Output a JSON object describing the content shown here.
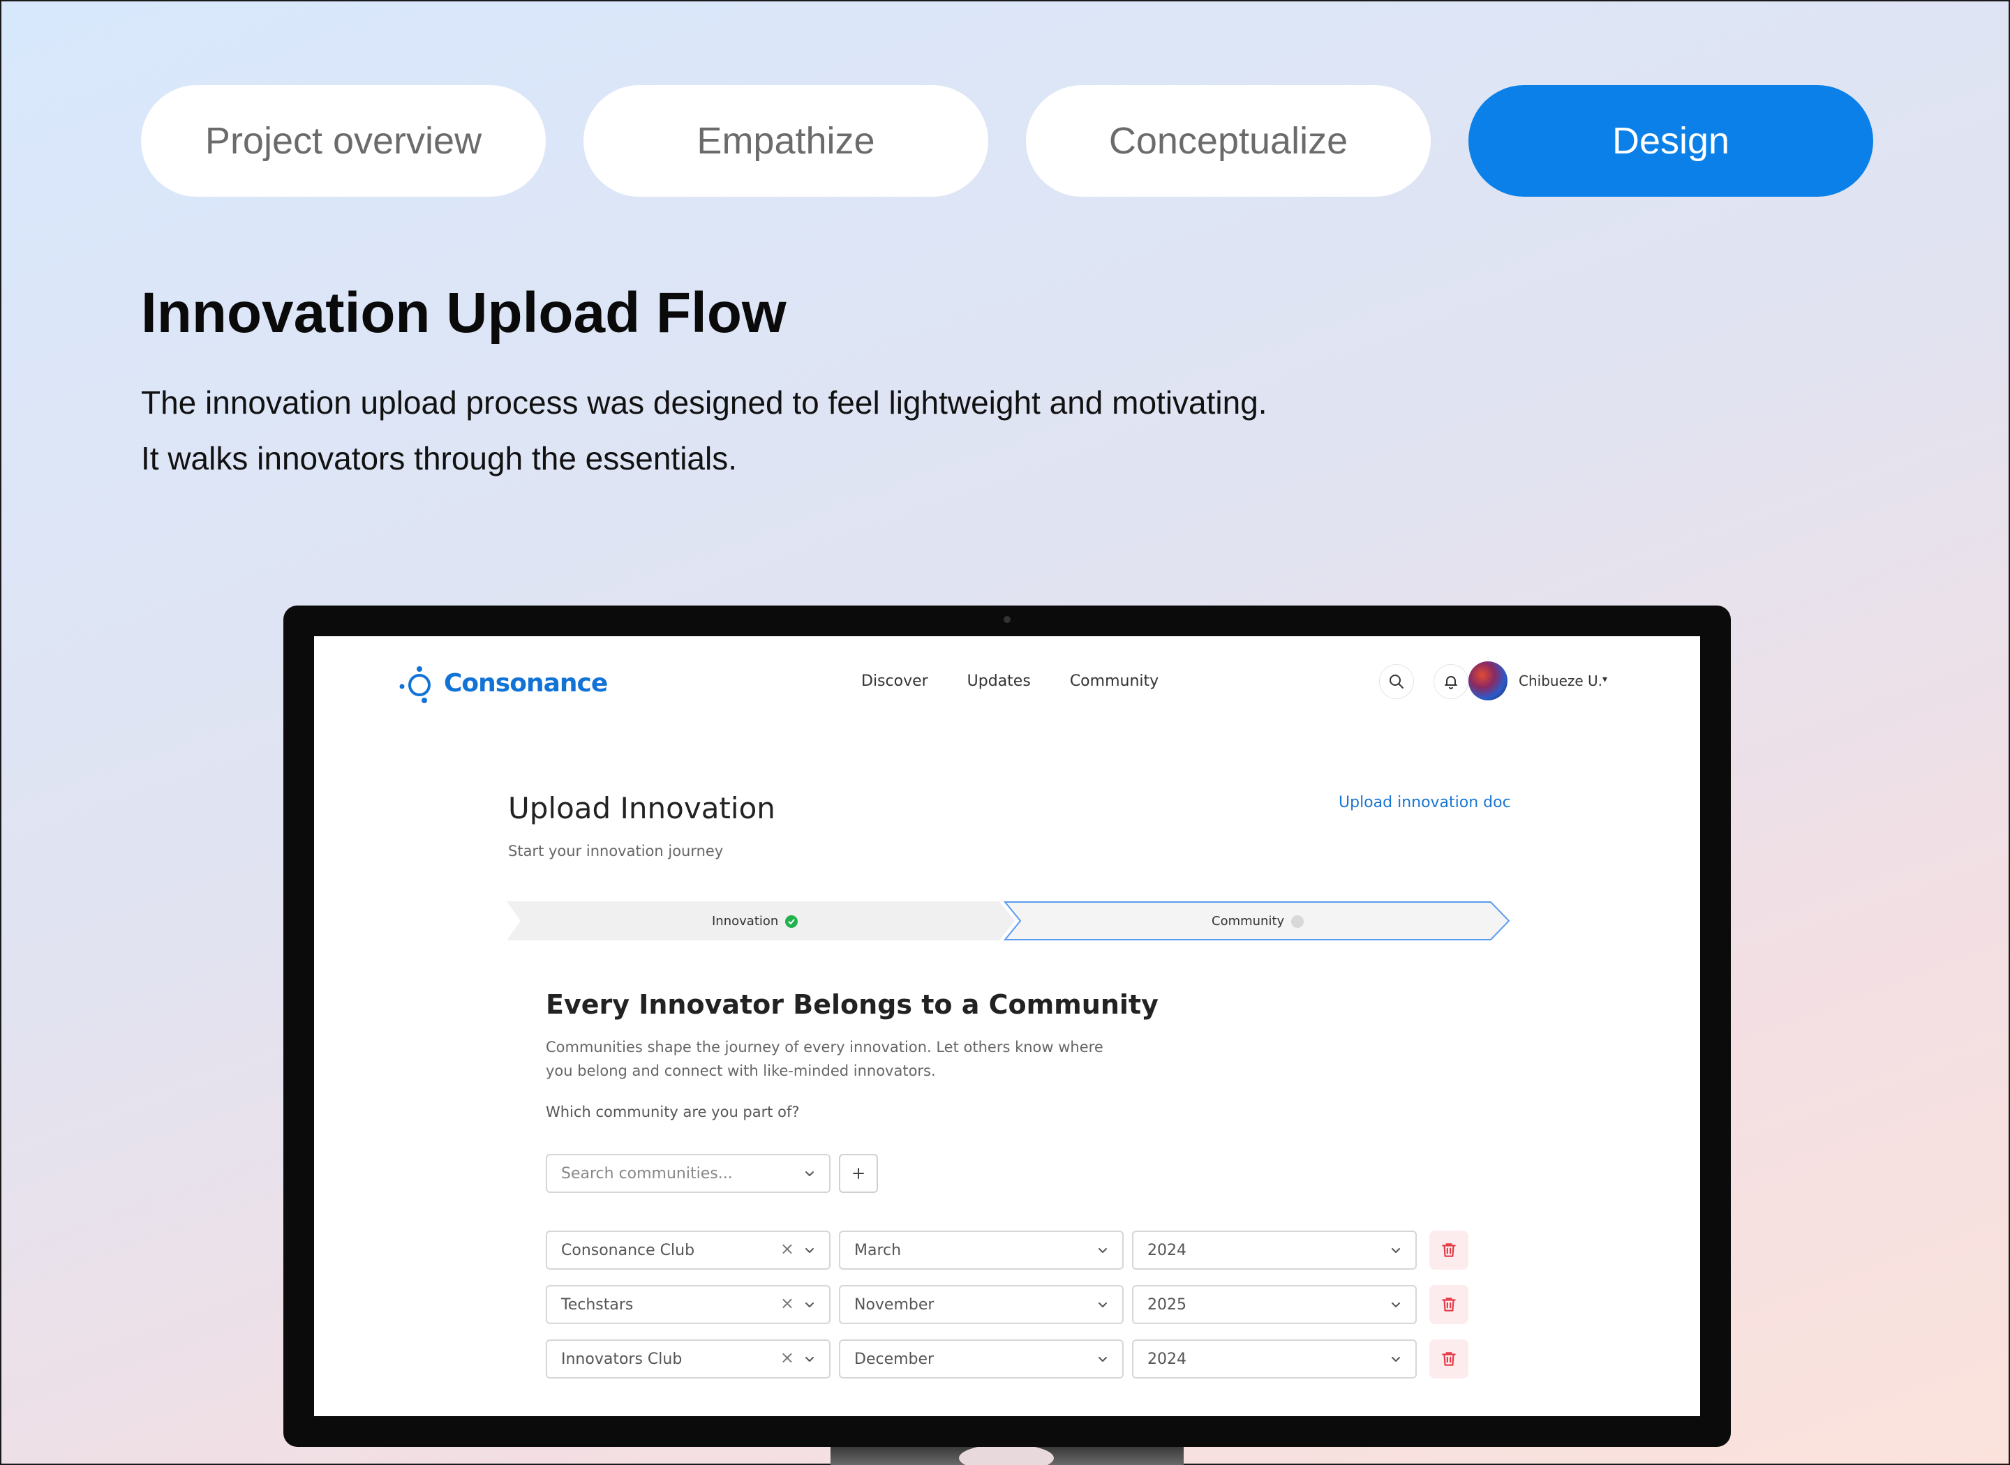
{
  "tabs": [
    {
      "label": "Project overview",
      "active": false
    },
    {
      "label": "Empathize",
      "active": false
    },
    {
      "label": "Conceptualize",
      "active": false
    },
    {
      "label": "Design",
      "active": true
    }
  ],
  "heading": "Innovation Upload Flow",
  "description": {
    "line1": "The innovation upload process was designed to feel lightweight and motivating.",
    "line2": "It walks innovators through the essentials."
  },
  "app": {
    "logo": "Consonance",
    "nav": [
      "Discover",
      "Updates",
      "Community"
    ],
    "user": {
      "name": "Chibueze U.",
      "caret": "▾"
    },
    "page": {
      "title": "Upload Innovation",
      "subtitle": "Start your innovation journey",
      "upload_doc_link": "Upload innovation doc"
    },
    "steps": [
      {
        "label": "Innovation",
        "status": "complete"
      },
      {
        "label": "Community",
        "status": "pending"
      }
    ],
    "section": {
      "title": "Every Innovator Belongs to a Community",
      "description": "Communities shape the journey of every innovation. Let others know where you belong and connect with like-minded innovators.",
      "question": "Which community are you part of?"
    },
    "search": {
      "placeholder": "Search communities..."
    },
    "clear_glyph": "×",
    "communities": [
      {
        "name": "Consonance Club",
        "month": "March",
        "year": "2024"
      },
      {
        "name": "Techstars",
        "month": "November",
        "year": "2025"
      },
      {
        "name": "Innovators Club",
        "month": "December",
        "year": "2024"
      }
    ]
  },
  "colors": {
    "accent": "#0a80e8",
    "brand": "#1273d6",
    "success": "#22b14c",
    "danger": "#e53946",
    "step_active_border": "#5b9cf0"
  }
}
